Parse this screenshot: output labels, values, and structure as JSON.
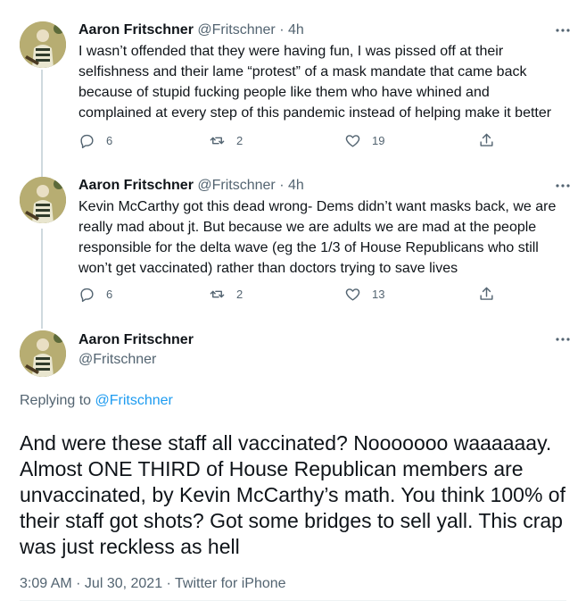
{
  "tweets": [
    {
      "name": "Aaron Fritschner",
      "handle": "@Fritschner",
      "time": "· 4h",
      "text": "I wasn’t offended that they were having fun, I was pissed off at their selfishness and their lame “protest” of a mask mandate that came back because of stupid fucking people like them who have whined and complained at every step of this pandemic instead of helping make it better",
      "replies": "6",
      "retweets": "2",
      "likes": "19"
    },
    {
      "name": "Aaron Fritschner",
      "handle": "@Fritschner",
      "time": "· 4h",
      "text": "Kevin McCarthy got this dead wrong- Dems didn’t want masks back, we are really mad about jt. But because we are adults we are mad at the people responsible for the delta wave (eg the 1/3 of House Republicans who still won’t get vaccinated) rather than doctors trying to save lives",
      "replies": "6",
      "retweets": "2",
      "likes": "13"
    }
  ],
  "main": {
    "name": "Aaron Fritschner",
    "handle": "@Fritschner",
    "replying_prefix": "Replying to",
    "replying_to": "@Fritschner",
    "text": "And were these staff all vaccinated? Nooooooo waaaaaay. Almost ONE THIRD of House Republican members are unvaccinated, by Kevin McCarthy’s math. You think 100% of their staff got shots? Got some bridges to sell yall. This crap was just reckless as hell",
    "timestamp": "3:09 AM · Jul 30, 2021 · Twitter for iPhone"
  },
  "colors": {
    "text": "#0f1419",
    "secondary": "#536471",
    "link": "#1d9bf0",
    "thread_line": "#cfd9de"
  },
  "icons": [
    "reply-icon",
    "retweet-icon",
    "like-icon",
    "share-icon",
    "more-icon"
  ]
}
